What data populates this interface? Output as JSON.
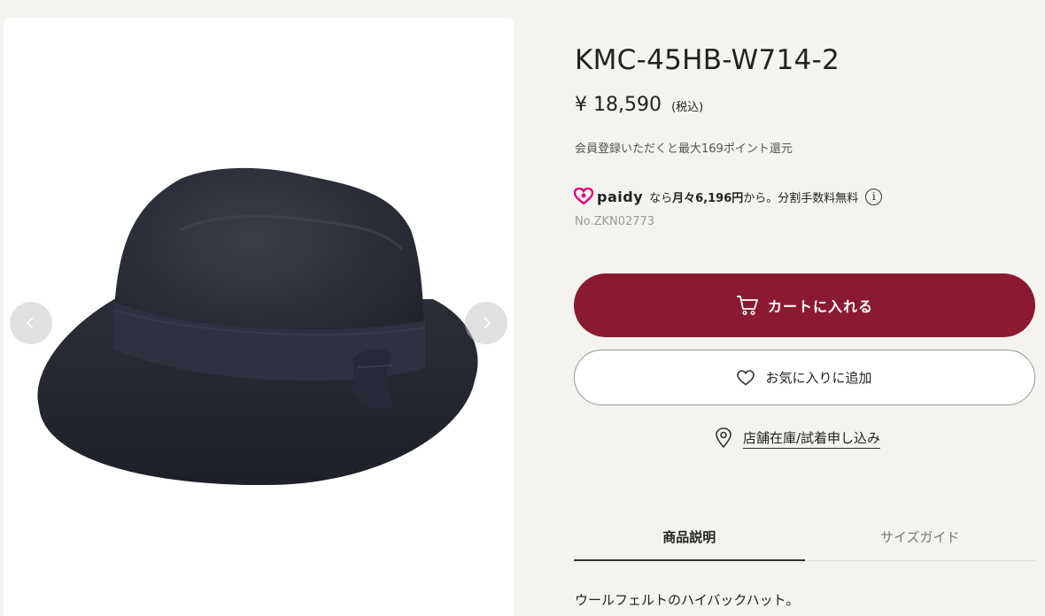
{
  "product": {
    "name": "KMC-45HB-W714-2",
    "price": "¥ 18,590",
    "tax_note": "(税込)",
    "points_note": "会員登録いただくと最大169ポイント還元",
    "product_no": "No.ZKN02773",
    "description": "ウールフェルトのハイバックハット。"
  },
  "paidy": {
    "logo_text": "paidy",
    "prefix": "なら",
    "amount": "月々6,196円",
    "suffix": "から。分割手数料無料",
    "info_icon": "i"
  },
  "actions": {
    "cart_label": "カートに入れる",
    "favorite_label": "お気に入りに追加",
    "store_label": "店舗在庫/試着申し込み"
  },
  "tabs": [
    {
      "label": "商品説明",
      "active": true
    },
    {
      "label": "サイズガイド",
      "active": false
    }
  ],
  "icons": {
    "carousel_prev": "chevron-left-icon",
    "carousel_next": "chevron-right-icon",
    "cart": "cart-icon",
    "favorite": "heart-icon",
    "store": "map-pin-icon",
    "info": "info-icon"
  },
  "colors": {
    "cart_button": "#8b1a30",
    "paidy_brand": "#e2007d",
    "background": "#f5f3ef"
  }
}
